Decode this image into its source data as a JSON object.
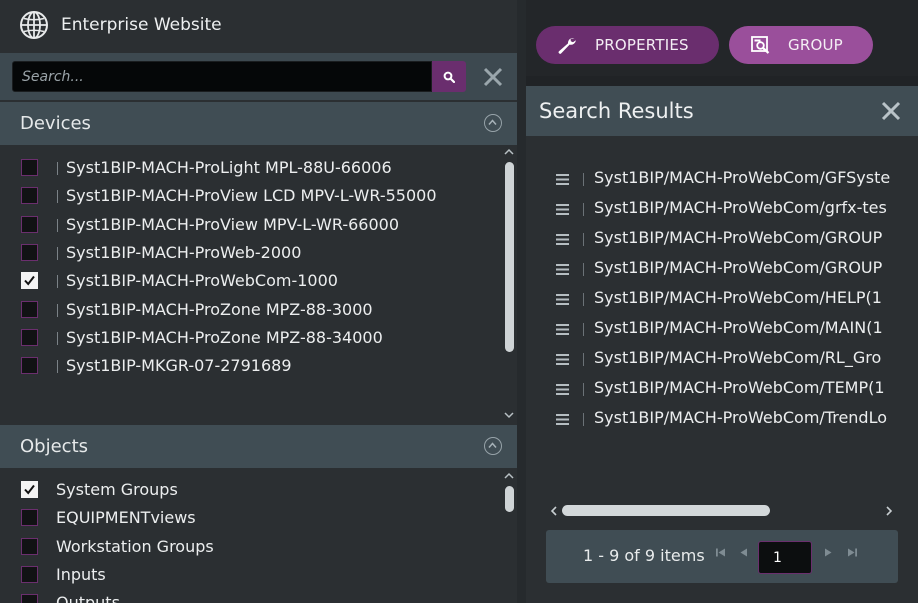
{
  "app": {
    "title": "Enterprise Website",
    "logo_icon": "globe-icon"
  },
  "search": {
    "placeholder": "Search...",
    "value": ""
  },
  "devices": {
    "title": "Devices",
    "items": [
      {
        "label": "Syst1BIP-MACH-ProLight MPL-88U-66006",
        "checked": false
      },
      {
        "label": "Syst1BIP-MACH-ProView LCD MPV-L-WR-55000",
        "checked": false
      },
      {
        "label": "Syst1BIP-MACH-ProView MPV-L-WR-66000",
        "checked": false
      },
      {
        "label": "Syst1BIP-MACH-ProWeb-2000",
        "checked": false
      },
      {
        "label": "Syst1BIP-MACH-ProWebCom-1000",
        "checked": true
      },
      {
        "label": "Syst1BIP-MACH-ProZone MPZ-88-3000",
        "checked": false
      },
      {
        "label": "Syst1BIP-MACH-ProZone MPZ-88-34000",
        "checked": false
      },
      {
        "label": "Syst1BIP-MKGR-07-2791689",
        "checked": false
      }
    ]
  },
  "objects": {
    "title": "Objects",
    "items": [
      {
        "label": "System Groups",
        "checked": true
      },
      {
        "label": "EQUIPMENTviews",
        "checked": false
      },
      {
        "label": "Workstation Groups",
        "checked": false
      },
      {
        "label": "Inputs",
        "checked": false
      },
      {
        "label": "Outputs",
        "checked": false
      }
    ]
  },
  "toolbar": {
    "properties_label": "PROPERTIES",
    "group_label": "GROUP"
  },
  "results": {
    "title": "Search Results",
    "items": [
      "Syst1BIP/MACH-ProWebCom/GFSyste",
      "Syst1BIP/MACH-ProWebCom/grfx-tes",
      "Syst1BIP/MACH-ProWebCom/GROUP",
      "Syst1BIP/MACH-ProWebCom/GROUP",
      "Syst1BIP/MACH-ProWebCom/HELP(1",
      "Syst1BIP/MACH-ProWebCom/MAIN(1",
      "Syst1BIP/MACH-ProWebCom/RL_Gro",
      "Syst1BIP/MACH-ProWebCom/TEMP(1",
      "Syst1BIP/MACH-ProWebCom/TrendLo"
    ]
  },
  "pager": {
    "info": "1 - 9 of 9 items",
    "page": "1"
  },
  "colors": {
    "accent": "#6a2e6e",
    "accent_light": "#9a4f9b",
    "header_bg": "#404d54"
  }
}
